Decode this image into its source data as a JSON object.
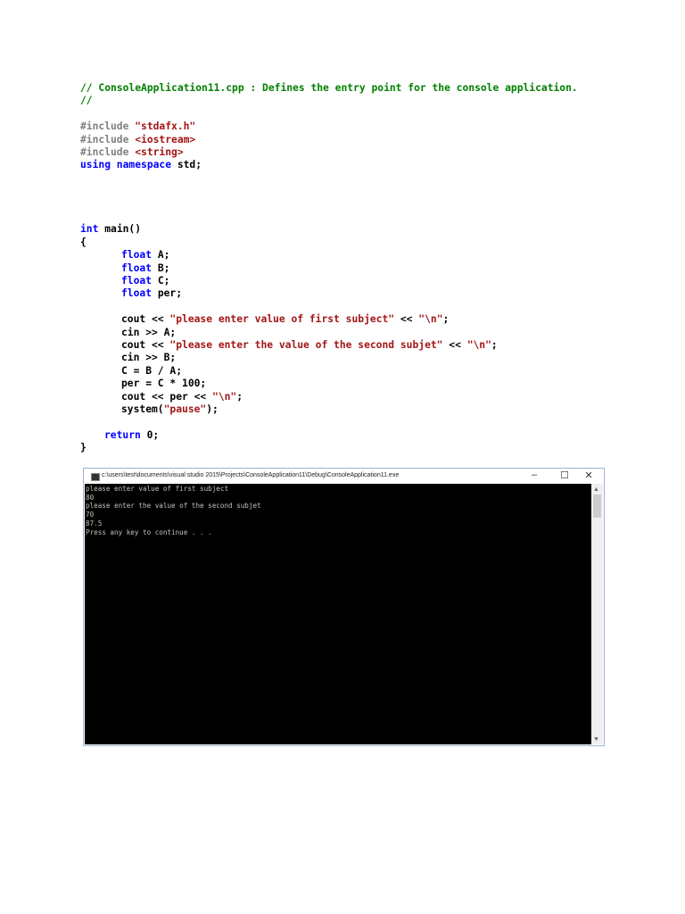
{
  "code_lines": [
    {
      "row": 0,
      "indent": 0,
      "tokens": [
        {
          "c": "c",
          "t": "// ConsoleApplication11.cpp : Defines the entry point for the console application."
        }
      ]
    },
    {
      "row": 1,
      "indent": 0,
      "tokens": [
        {
          "c": "c",
          "t": "//"
        }
      ]
    },
    {
      "row": 3,
      "indent": 0,
      "tokens": [
        {
          "c": "p",
          "t": "#include "
        },
        {
          "c": "s",
          "t": "\"stdafx.h\""
        }
      ]
    },
    {
      "row": 4,
      "indent": 0,
      "tokens": [
        {
          "c": "p",
          "t": "#include "
        },
        {
          "c": "s",
          "t": "<iostream>"
        }
      ]
    },
    {
      "row": 5,
      "indent": 0,
      "tokens": [
        {
          "c": "p",
          "t": "#include "
        },
        {
          "c": "s",
          "t": "<string>"
        }
      ]
    },
    {
      "row": 6,
      "indent": 0,
      "tokens": [
        {
          "c": "k",
          "t": "using namespace "
        },
        {
          "c": "t",
          "t": "std;"
        }
      ]
    },
    {
      "row": 11,
      "indent": 0,
      "tokens": [
        {
          "c": "k",
          "t": "int "
        },
        {
          "c": "t",
          "t": "main()"
        }
      ]
    },
    {
      "row": 12,
      "indent": 0,
      "tokens": [
        {
          "c": "t",
          "t": "{"
        }
      ]
    },
    {
      "row": 13,
      "indent": 2,
      "tokens": [
        {
          "c": "k",
          "t": "float "
        },
        {
          "c": "t",
          "t": "A;"
        }
      ]
    },
    {
      "row": 14,
      "indent": 2,
      "tokens": [
        {
          "c": "k",
          "t": "float "
        },
        {
          "c": "t",
          "t": "B;"
        }
      ]
    },
    {
      "row": 15,
      "indent": 2,
      "tokens": [
        {
          "c": "k",
          "t": "float "
        },
        {
          "c": "t",
          "t": "C;"
        }
      ]
    },
    {
      "row": 16,
      "indent": 2,
      "tokens": [
        {
          "c": "k",
          "t": "float "
        },
        {
          "c": "t",
          "t": "per;"
        }
      ]
    },
    {
      "row": 18,
      "indent": 2,
      "tokens": [
        {
          "c": "t",
          "t": "cout << "
        },
        {
          "c": "s",
          "t": "\"please enter value of first subject\""
        },
        {
          "c": "t",
          "t": " << "
        },
        {
          "c": "s",
          "t": "\"\\n\""
        },
        {
          "c": "t",
          "t": ";"
        }
      ]
    },
    {
      "row": 19,
      "indent": 2,
      "tokens": [
        {
          "c": "t",
          "t": "cin >> A;"
        }
      ]
    },
    {
      "row": 20,
      "indent": 2,
      "tokens": [
        {
          "c": "t",
          "t": "cout << "
        },
        {
          "c": "s",
          "t": "\"please enter the value of the second subjet\""
        },
        {
          "c": "t",
          "t": " << "
        },
        {
          "c": "s",
          "t": "\"\\n\""
        },
        {
          "c": "t",
          "t": ";"
        }
      ]
    },
    {
      "row": 21,
      "indent": 2,
      "tokens": [
        {
          "c": "t",
          "t": "cin >> B;"
        }
      ]
    },
    {
      "row": 22,
      "indent": 2,
      "tokens": [
        {
          "c": "t",
          "t": "C = B / A;"
        }
      ]
    },
    {
      "row": 23,
      "indent": 2,
      "tokens": [
        {
          "c": "t",
          "t": "per = C * 100;"
        }
      ]
    },
    {
      "row": 24,
      "indent": 2,
      "tokens": [
        {
          "c": "t",
          "t": "cout << per << "
        },
        {
          "c": "s",
          "t": "\"\\n\""
        },
        {
          "c": "t",
          "t": ";"
        }
      ]
    },
    {
      "row": 25,
      "indent": 2,
      "tokens": [
        {
          "c": "t",
          "t": "system("
        },
        {
          "c": "s",
          "t": "\"pause\""
        },
        {
          "c": "t",
          "t": ");"
        }
      ]
    },
    {
      "row": 27,
      "indent": 1,
      "tokens": [
        {
          "c": "k",
          "t": "return "
        },
        {
          "c": "t",
          "t": "0;"
        }
      ]
    },
    {
      "row": 28,
      "indent": 0,
      "tokens": [
        {
          "c": "t",
          "t": "}"
        }
      ]
    }
  ],
  "console_window": {
    "title": "c:\\users\\test\\documents\\visual studio 2015\\Projects\\ConsoleApplication11\\Debug\\ConsoleApplication11.exe",
    "minimize": "–",
    "maximize": "☐",
    "close": "✕",
    "output": [
      "please enter value of first subject",
      "80",
      "please enter the value of the second subjet",
      "70",
      "87.5",
      "Press any key to continue . . ."
    ]
  }
}
